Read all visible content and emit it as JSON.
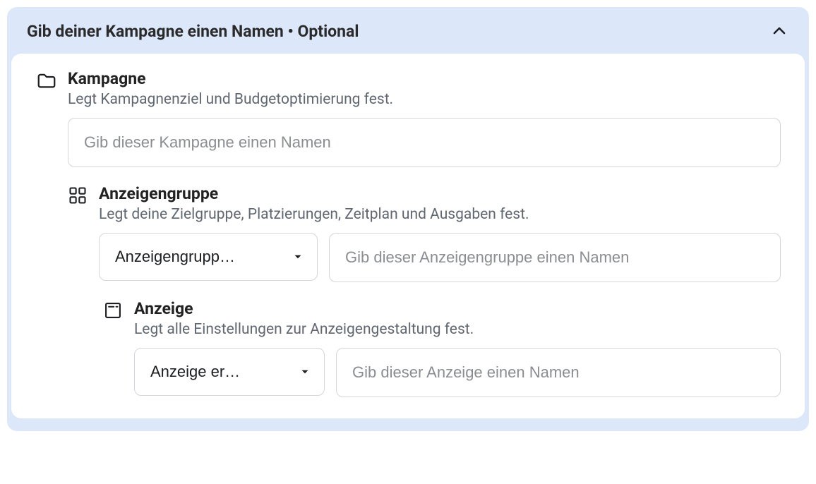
{
  "header": {
    "title": "Gib deiner Kampagne einen Namen • Optional"
  },
  "campaign": {
    "heading": "Kampagne",
    "subtitle": "Legt Kampagnenziel und Budgetoptimierung fest.",
    "placeholder": "Gib dieser Kampagne einen Namen"
  },
  "adset": {
    "heading": "Anzeigengruppe",
    "subtitle": "Legt deine Zielgruppe, Platzierungen, Zeitplan und Ausgaben fest.",
    "dropdown_label": "Anzeigengrupp…",
    "placeholder": "Gib dieser Anzeigengruppe einen Namen"
  },
  "ad": {
    "heading": "Anzeige",
    "subtitle": "Legt alle Einstellungen zur Anzeigengestaltung fest.",
    "dropdown_label": "Anzeige er…",
    "placeholder": "Gib dieser Anzeige einen Namen"
  }
}
